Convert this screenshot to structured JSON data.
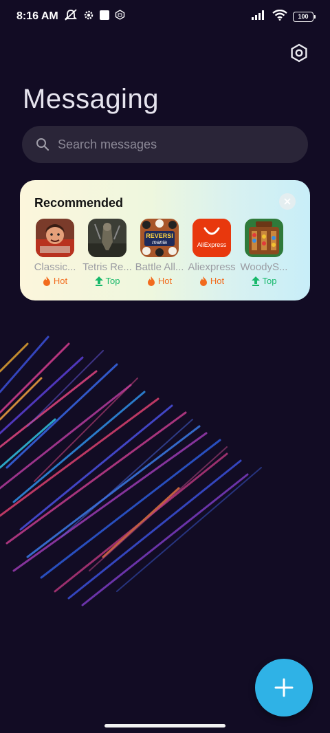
{
  "status_bar": {
    "time": "8:16 AM",
    "icons_left": [
      "mute-icon",
      "settings-gear-icon",
      "square-notification-icon",
      "mi-icon"
    ],
    "icons_right": [
      "signal-icon",
      "wifi-icon"
    ],
    "battery": "100"
  },
  "header": {
    "title": "Messaging",
    "settings_icon": "settings-icon"
  },
  "search": {
    "placeholder": "Search messages"
  },
  "recommended": {
    "title": "Recommended",
    "apps": [
      {
        "name": "Classic...",
        "badge": "Hot",
        "badge_type": "hot"
      },
      {
        "name": "Tetris Re...",
        "badge": "Top",
        "badge_type": "top"
      },
      {
        "name": "Battle All...",
        "badge": "Hot",
        "badge_type": "hot"
      },
      {
        "name": "Aliexpress",
        "badge": "Hot",
        "badge_type": "hot",
        "icon_text": "AliExpress"
      },
      {
        "name": "WoodyS...",
        "badge": "Top",
        "badge_type": "top"
      }
    ]
  },
  "colors": {
    "background": "#120c24",
    "fab": "#2fb2e6",
    "hot": "#f26b1d",
    "top": "#16b86a"
  },
  "fab": {
    "icon": "plus-icon"
  }
}
